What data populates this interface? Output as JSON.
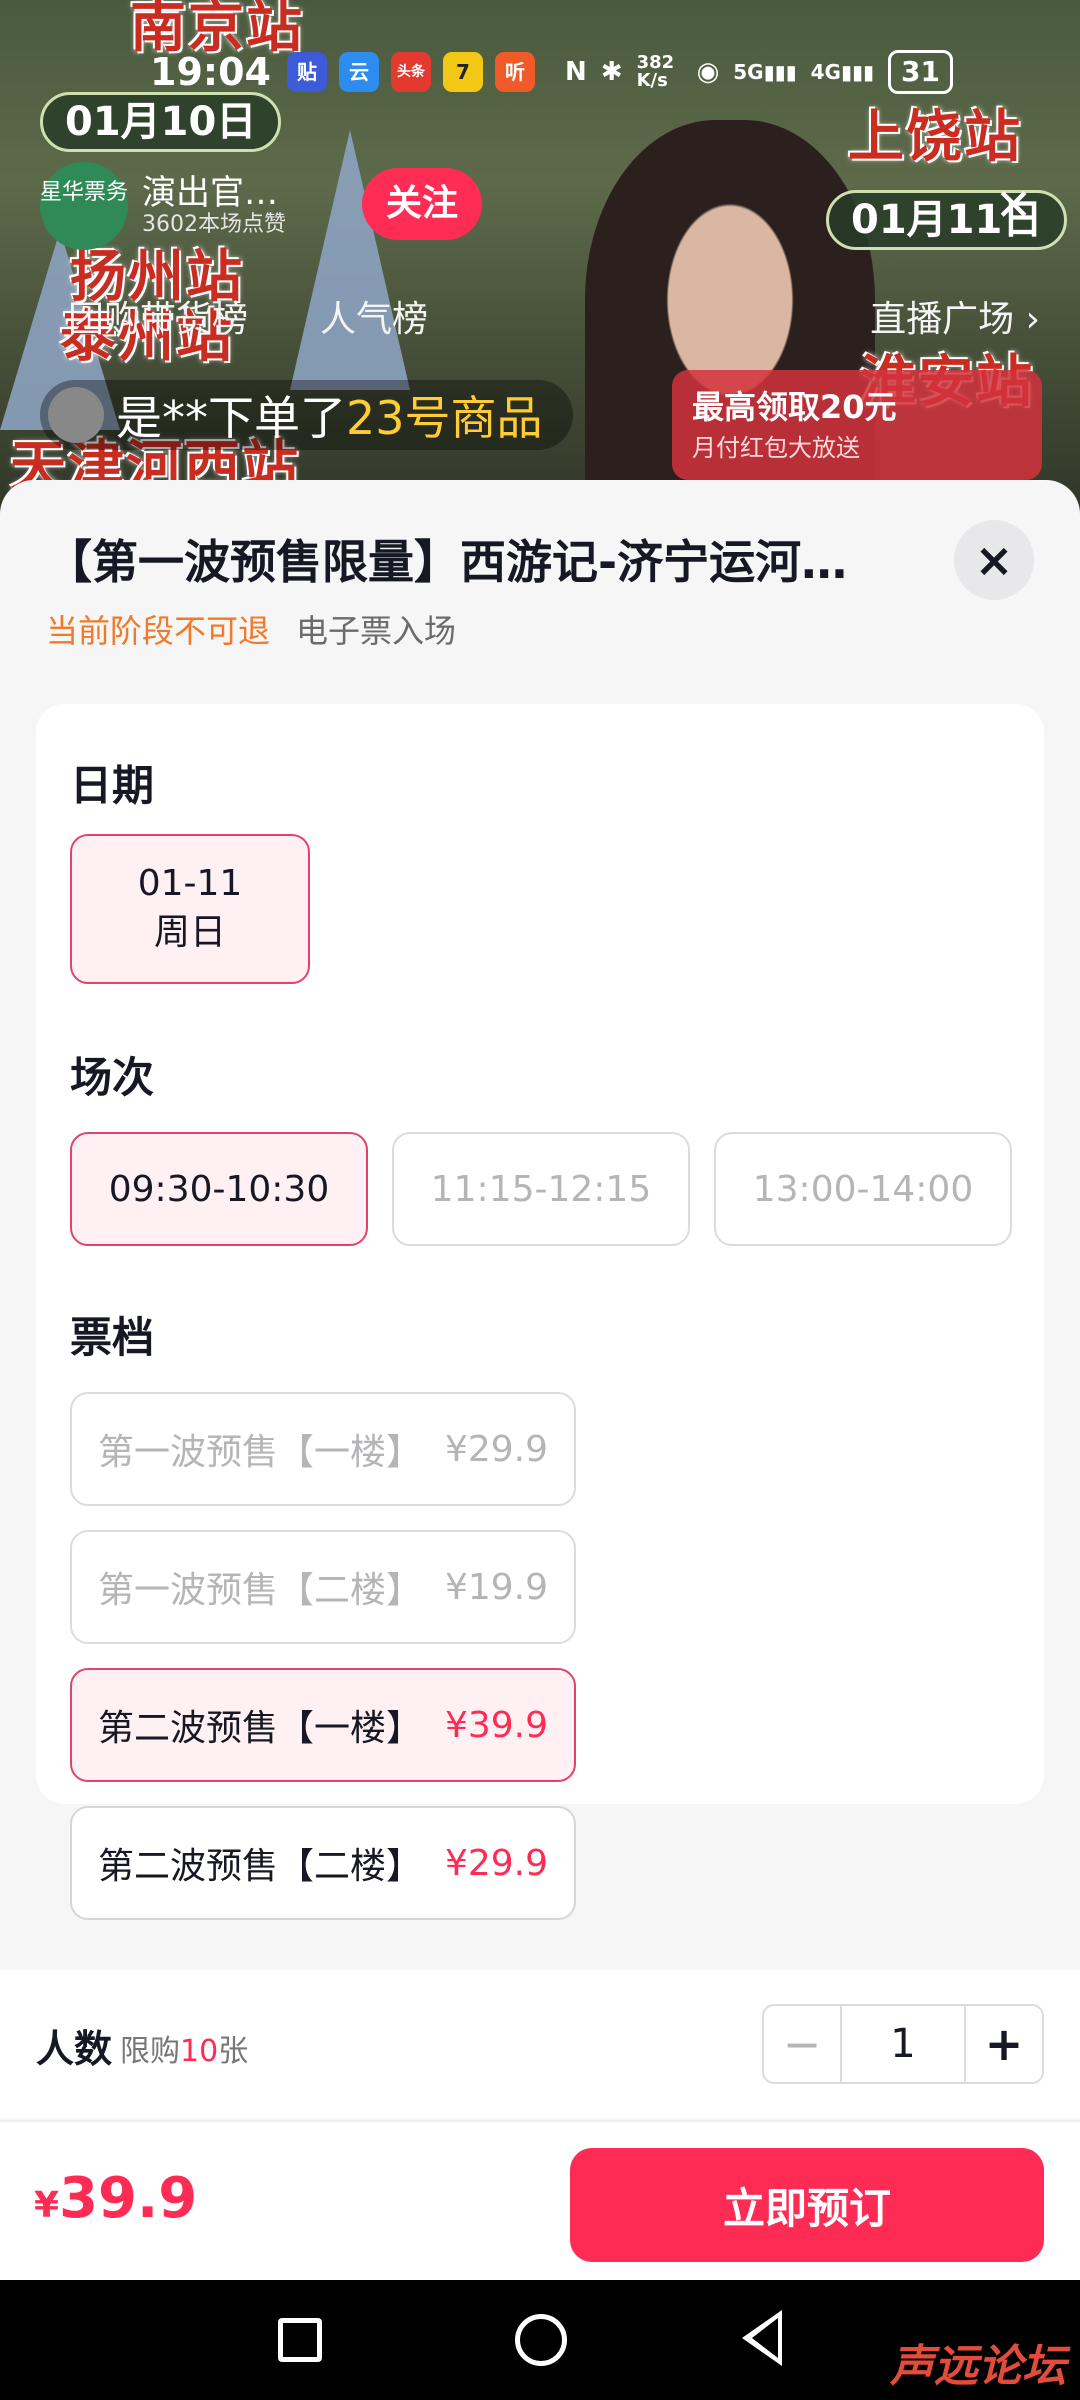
{
  "status_bar": {
    "time": "19:04",
    "apps": [
      "贴",
      "云",
      "头条",
      "7",
      "听"
    ],
    "network_speed": "382 K/s",
    "net_5g": "5G",
    "net_4g": "4G",
    "battery": "31"
  },
  "live": {
    "date_left": "01月10日",
    "date_right": "01月11日",
    "host_avatar_text": "星华票务",
    "host_name": "演出官…",
    "host_likes": "3602本场点赞",
    "follow_label": "关注",
    "tab_group_buy": "团购带货榜",
    "tab_popular": "人气榜",
    "plaza": "直播广场 ›",
    "ticker_prefix": "是**下单了",
    "ticker_highlight": "23号商品",
    "redpack_title": "最高领取20元",
    "redpack_sub": "月付红包大放送",
    "banner_texts": [
      "扬州站",
      "泰州站",
      "天津河西站",
      "上饶站",
      "淮安站",
      "南京站"
    ]
  },
  "sheet": {
    "title": "【第一波预售限量】西游记-济宁运河…",
    "close_icon": "×",
    "tag_refund": "当前阶段不可退",
    "tag_ticket": "电子票入场",
    "date_label": "日期",
    "date_options": [
      {
        "date": "01-11",
        "weekday": "周日",
        "state": "selected"
      }
    ],
    "session_label": "场次",
    "sessions": [
      {
        "time": "09:30-10:30",
        "state": "selected"
      },
      {
        "time": "11:15-12:15",
        "state": "disabled"
      },
      {
        "time": "13:00-14:00",
        "state": "disabled"
      }
    ],
    "tier_label": "票档",
    "tiers": [
      {
        "name": "第一波预售【一楼】",
        "price": "¥29.9",
        "state": "disabled"
      },
      {
        "name": "第一波预售【二楼】",
        "price": "¥19.9",
        "state": "disabled"
      },
      {
        "name": "第二波预售【一楼】",
        "price": "¥39.9",
        "state": "selected"
      },
      {
        "name": "第二波预售【二楼】",
        "price": "¥29.9",
        "state": "normal"
      }
    ],
    "qty_label": "人数",
    "qty_limit_prefix": "限购",
    "qty_limit_num": "10",
    "qty_limit_suffix": "张",
    "qty_minus": "−",
    "qty_value": "1",
    "qty_plus": "+",
    "currency": "¥",
    "total": "39.9",
    "book_label": "立即预订"
  },
  "watermark": "声远论坛",
  "colors": {
    "accent": "#fe2c55",
    "selected_bg": "#fff1f3",
    "warn": "#f0792b"
  }
}
